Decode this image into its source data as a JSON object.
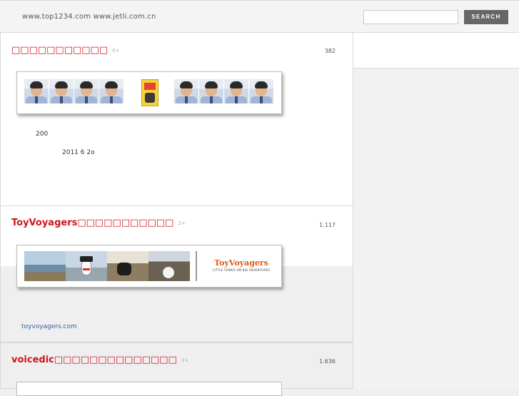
{
  "header": {
    "site_url": "www.top1234.com www.jetli.com.cn",
    "search_placeholder": "",
    "search_label": "SEARCH"
  },
  "posts": [
    {
      "title": "□□□□□□□□□□□",
      "comments": "0+",
      "views": "382",
      "body_lines": [
        "200",
        "2011 6 2o"
      ]
    },
    {
      "title": "ToyVoyagers□□□□□□□□□□□",
      "comments": "2+",
      "views": "1.117",
      "logo_name": "ToyVoyagers",
      "logo_tagline": "LITTLE THINGS ON BIG ADVENTURES",
      "link": "toyvoyagers.com"
    },
    {
      "title": "voicedic□□□□□□□□□□□□□□",
      "comments": "1+",
      "views": "1.636"
    }
  ],
  "colors": {
    "title_red": "#d2141b",
    "link_blue": "#2e67a8",
    "search_button": "#666666"
  }
}
